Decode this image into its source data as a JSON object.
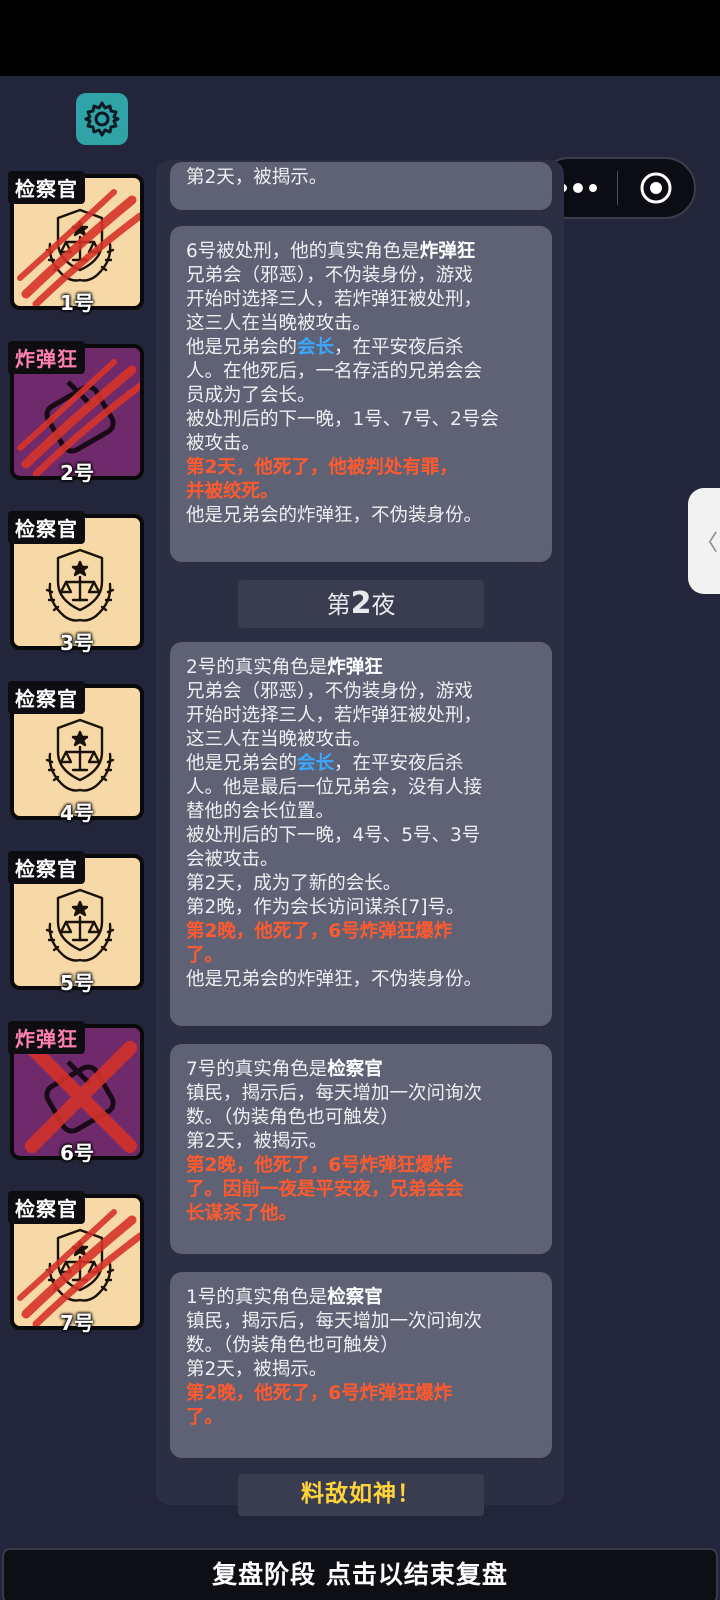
{
  "header": {
    "settings_icon": "gear-icon",
    "capsule_more_icon": "more-dots-icon",
    "capsule_close_icon": "target-circle-icon",
    "side_tab_icon": "chevron-left-icon",
    "side_tab_label": "〈"
  },
  "players": [
    {
      "role": "检察官",
      "number": "1号",
      "type": "prosecutor",
      "status": "clawed"
    },
    {
      "role": "炸弹狂",
      "number": "2号",
      "type": "bomber",
      "status": "clawed"
    },
    {
      "role": "检察官",
      "number": "3号",
      "type": "prosecutor",
      "status": "alive"
    },
    {
      "role": "检察官",
      "number": "4号",
      "type": "prosecutor",
      "status": "alive"
    },
    {
      "role": "检察官",
      "number": "5号",
      "type": "prosecutor",
      "status": "alive"
    },
    {
      "role": "炸弹狂",
      "number": "6号",
      "type": "bomber",
      "status": "crossed"
    },
    {
      "role": "检察官",
      "number": "7号",
      "type": "prosecutor",
      "status": "clawed"
    }
  ],
  "log": {
    "entry0": {
      "line1": "第2天，被揭示。"
    },
    "entry1": {
      "l1a": "6号被处刑，他的真实角色是",
      "l1b": "炸弹狂",
      "l2": "兄弟会（邪恶），不伪装身份，游戏",
      "l3": "开始时选择三人，若炸弹狂被处刑，",
      "l4": "这三人在当晚被攻击。",
      "l5a": "他是兄弟会的",
      "l5b": "会长",
      "l5c": "，在平安夜后杀",
      "l6": "人。在他死后，一名存活的兄弟会会",
      "l7": "员成为了会长。",
      "l8": "被处刑后的下一晚，1号、7号、2号会",
      "l9": "被攻击。",
      "r1": "第2天，他死了，他被判处有罪，",
      "r2": "并被绞死。",
      "l10": "他是兄弟会的炸弹狂，不伪装身份。"
    },
    "night_header": {
      "prefix": "第",
      "num": "2",
      "suffix": "夜"
    },
    "entry2": {
      "l1a": "2号的真实角色是",
      "l1b": "炸弹狂",
      "l2": "兄弟会（邪恶），不伪装身份，游戏",
      "l3": "开始时选择三人，若炸弹狂被处刑，",
      "l4": "这三人在当晚被攻击。",
      "l5a": "他是兄弟会的",
      "l5b": "会长",
      "l5c": "，在平安夜后杀",
      "l6": "人。他是最后一位兄弟会，没有人接",
      "l7": "替他的会长位置。",
      "l8": "被处刑后的下一晚，4号、5号、3号",
      "l9": "会被攻击。",
      "l10": "第2天，成为了新的会长。",
      "l11": "第2晚，作为会长访问谋杀[7]号。",
      "r1": "第2晚，他死了，6号炸弹狂爆炸",
      "r2": "了。",
      "l12": "他是兄弟会的炸弹狂，不伪装身份。"
    },
    "entry3": {
      "l1a": "7号的真实角色是",
      "l1b": "检察官",
      "l2": "镇民，揭示后，每天增加一次问询次",
      "l3": "数。（伪装角色也可触发）",
      "l4": "第2天，被揭示。",
      "r1": "第2晚，他死了，6号炸弹狂爆炸",
      "r2": "了。因前一夜是平安夜，兄弟会会",
      "r3": "长谋杀了他。"
    },
    "entry4": {
      "l1a": "1号的真实角色是",
      "l1b": "检察官",
      "l2": "镇民，揭示后，每天增加一次问询次",
      "l3": "数。（伪装角色也可触发）",
      "l4": "第2天，被揭示。",
      "r1": "第2晚，他死了，6号炸弹狂爆炸",
      "r2": "了。"
    },
    "summary": "料敌如神！"
  },
  "bottom_bar": {
    "label": "复盘阶段 点击以结束复盘"
  },
  "colors": {
    "background": "#23253a",
    "card_prosecutor": "#f6d9a6",
    "card_bomber": "#6e2a6a",
    "death_red": "#ff5a2e",
    "leader_blue": "#39a8ff",
    "summary_yellow": "#ffd43a",
    "settings_teal": "#2fa3a6"
  }
}
